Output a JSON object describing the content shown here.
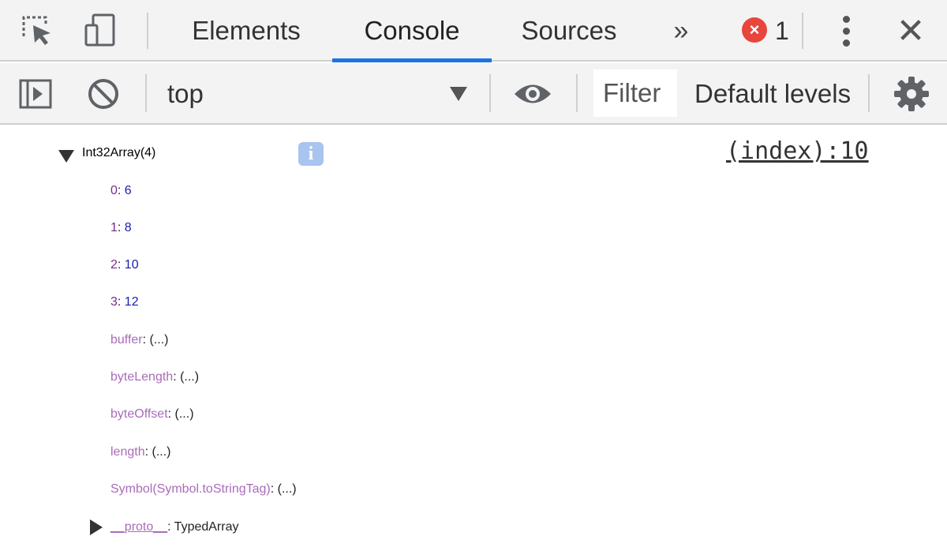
{
  "tabbar": {
    "tabs": [
      {
        "label": "Elements",
        "active": false
      },
      {
        "label": "Console",
        "active": true
      },
      {
        "label": "Sources",
        "active": false
      }
    ],
    "more_tabs": "»",
    "error_badge_glyph": "×",
    "error_count": "1",
    "accent_color": "#1a73e8",
    "icons": [
      "inspect-element-icon",
      "device-toolbar-icon",
      "more-options-icon",
      "close-icon"
    ]
  },
  "toolbar": {
    "context": "top",
    "filter_placeholder": "Filter",
    "levels_label": "Default levels",
    "icons": [
      "sidebar-toggle-icon",
      "clear-console-icon",
      "live-expression-eye-icon",
      "settings-gear-icon"
    ]
  },
  "console": {
    "header": "Int32Array(4)",
    "info_glyph": "i",
    "source_link": "(index):10",
    "entries": [
      {
        "key": "0",
        "value": "6"
      },
      {
        "key": "1",
        "value": "8"
      },
      {
        "key": "2",
        "value": "10"
      },
      {
        "key": "3",
        "value": "12"
      }
    ],
    "accessors": [
      {
        "key": "buffer",
        "value": "(...)"
      },
      {
        "key": "byteLength",
        "value": "(...)"
      },
      {
        "key": "byteOffset",
        "value": "(...)"
      },
      {
        "key": "length",
        "value": "(...)"
      },
      {
        "key": "Symbol(Symbol.toStringTag)",
        "value": "(...)"
      }
    ],
    "proto": {
      "key": "__proto__",
      "value": "TypedArray"
    }
  }
}
